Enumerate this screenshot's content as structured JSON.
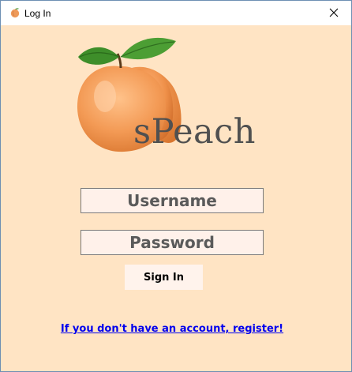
{
  "window": {
    "title": "Log In",
    "close_symbol": "X"
  },
  "branding": {
    "app_name": "sPeach",
    "logo_icon": "peach-icon"
  },
  "form": {
    "username_placeholder": "Username",
    "password_placeholder": "Password",
    "signin_label": "Sign In",
    "register_link": "If you don't have an account, register!"
  },
  "colors": {
    "background": "#ffe4c4",
    "field_background": "#fff1ea",
    "link": "#0000ee"
  }
}
